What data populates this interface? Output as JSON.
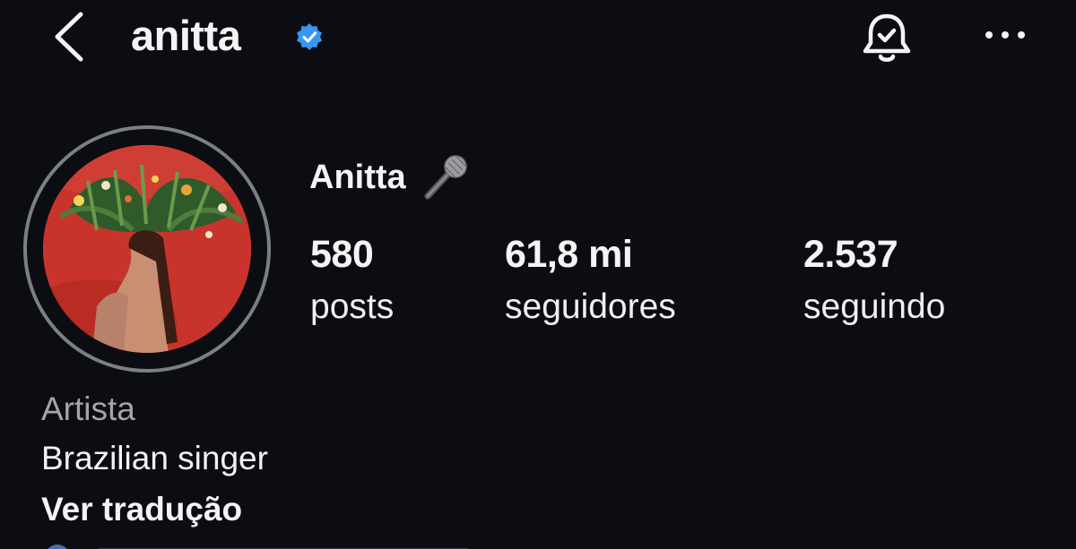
{
  "header": {
    "username": "anitta",
    "verified_color": "#3897f0",
    "icons": [
      "chevron-left-icon",
      "verified-badge-icon",
      "bell-check-icon",
      "more-horizontal-icon"
    ]
  },
  "profile": {
    "display_name": "Anitta",
    "name_emoji": "microphone-icon",
    "stats": [
      {
        "value": "580",
        "label": "posts"
      },
      {
        "value": "61,8 mi",
        "label": "seguidores"
      },
      {
        "value": "2.537",
        "label": "seguindo"
      }
    ],
    "category": "Artista",
    "bio": "Brazilian singer",
    "translate_label": "Ver tradução"
  },
  "colors": {
    "background": "#0c0d12",
    "text": "#f4f4f4",
    "muted_text": "#a4a5ab",
    "ring": "#7d7f86",
    "photo_red": "#c8342b"
  }
}
